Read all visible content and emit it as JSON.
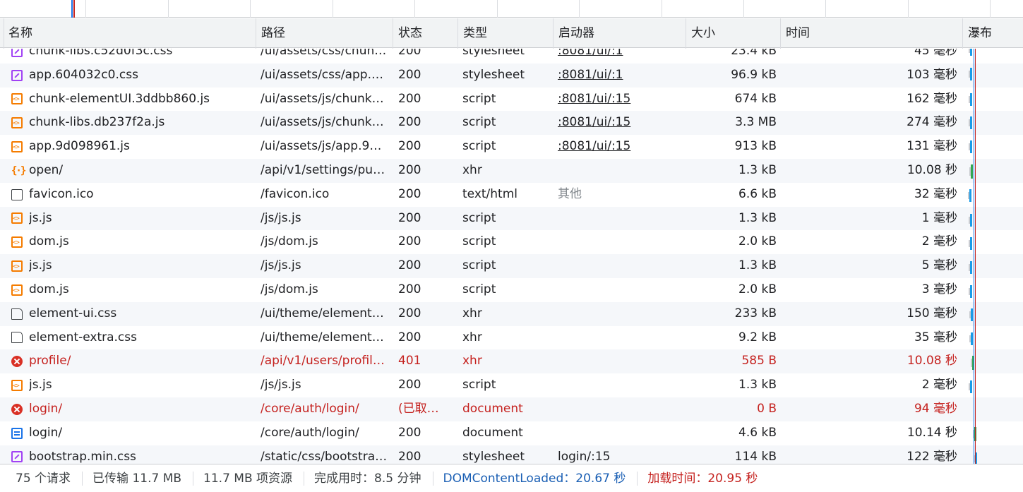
{
  "columns": {
    "name": "名称",
    "path": "路径",
    "status": "状态",
    "type": "类型",
    "initiator": "启动器",
    "size": "大小",
    "time": "时间",
    "waterfall": "瀑布"
  },
  "rows": [
    {
      "icon": "css-file-icon",
      "name": "chunk-libs.c52d0f3c.css",
      "path": "/ui/assets/css/chun…",
      "status": "200",
      "type": "stylesheet",
      "initiator": ":8081/ui/:1",
      "initiator_link": true,
      "size": "23.4 kB",
      "time": "45 毫秒",
      "error": false
    },
    {
      "icon": "css-file-icon",
      "name": "app.604032c0.css",
      "path": "/ui/assets/css/app.…",
      "status": "200",
      "type": "stylesheet",
      "initiator": ":8081/ui/:1",
      "initiator_link": true,
      "size": "96.9 kB",
      "time": "103 毫秒",
      "error": false
    },
    {
      "icon": "js-file-icon",
      "name": "chunk-elementUI.3ddbb860.js",
      "path": "/ui/assets/js/chunk…",
      "status": "200",
      "type": "script",
      "initiator": ":8081/ui/:15",
      "initiator_link": true,
      "size": "674 kB",
      "time": "162 毫秒",
      "error": false
    },
    {
      "icon": "js-file-icon",
      "name": "chunk-libs.db237f2a.js",
      "path": "/ui/assets/js/chunk…",
      "status": "200",
      "type": "script",
      "initiator": ":8081/ui/:15",
      "initiator_link": true,
      "size": "3.3 MB",
      "time": "274 毫秒",
      "error": false
    },
    {
      "icon": "js-file-icon",
      "name": "app.9d098961.js",
      "path": "/ui/assets/js/app.9…",
      "status": "200",
      "type": "script",
      "initiator": ":8081/ui/:15",
      "initiator_link": true,
      "size": "913 kB",
      "time": "131 毫秒",
      "error": false
    },
    {
      "icon": "xhr-icon",
      "name": "open/",
      "path": "/api/v1/settings/pu…",
      "status": "200",
      "type": "xhr",
      "initiator": "",
      "initiator_link": false,
      "size": "1.3 kB",
      "time": "10.08 秒",
      "error": false
    },
    {
      "icon": "blank-file-icon",
      "name": "favicon.ico",
      "path": "/favicon.ico",
      "status": "200",
      "type": "text/html",
      "initiator": "其他",
      "initiator_link": false,
      "initiator_muted": true,
      "size": "6.6 kB",
      "time": "32 毫秒",
      "error": false
    },
    {
      "icon": "js-file-icon",
      "name": "js.js",
      "path": "/js/js.js",
      "status": "200",
      "type": "script",
      "initiator": "",
      "initiator_link": false,
      "size": "1.3 kB",
      "time": "1 毫秒",
      "error": false
    },
    {
      "icon": "js-file-icon",
      "name": "dom.js",
      "path": "/js/dom.js",
      "status": "200",
      "type": "script",
      "initiator": "",
      "initiator_link": false,
      "size": "2.0 kB",
      "time": "2 毫秒",
      "error": false
    },
    {
      "icon": "js-file-icon",
      "name": "js.js",
      "path": "/js/js.js",
      "status": "200",
      "type": "script",
      "initiator": "",
      "initiator_link": false,
      "size": "1.3 kB",
      "time": "5 毫秒",
      "error": false
    },
    {
      "icon": "js-file-icon",
      "name": "dom.js",
      "path": "/js/dom.js",
      "status": "200",
      "type": "script",
      "initiator": "",
      "initiator_link": false,
      "size": "2.0 kB",
      "time": "3 毫秒",
      "error": false
    },
    {
      "icon": "document-file-icon",
      "name": "element-ui.css",
      "path": "/ui/theme/element…",
      "status": "200",
      "type": "xhr",
      "initiator": "",
      "initiator_link": false,
      "size": "233 kB",
      "time": "150 毫秒",
      "error": false
    },
    {
      "icon": "document-file-icon",
      "name": "element-extra.css",
      "path": "/ui/theme/element…",
      "status": "200",
      "type": "xhr",
      "initiator": "",
      "initiator_link": false,
      "size": "9.2 kB",
      "time": "35 毫秒",
      "error": false
    },
    {
      "icon": "error-icon",
      "name": "profile/",
      "path": "/api/v1/users/profil…",
      "status": "401",
      "type": "xhr",
      "initiator": "",
      "initiator_link": false,
      "size": "585 B",
      "time": "10.08 秒",
      "error": true
    },
    {
      "icon": "js-file-icon",
      "name": "js.js",
      "path": "/js/js.js",
      "status": "200",
      "type": "script",
      "initiator": "",
      "initiator_link": false,
      "size": "1.3 kB",
      "time": "2 毫秒",
      "error": false
    },
    {
      "icon": "error-icon",
      "name": "login/",
      "path": "/core/auth/login/",
      "status": "(已取…",
      "type": "document",
      "initiator": "",
      "initiator_link": false,
      "size": "0 B",
      "time": "94 毫秒",
      "error": true
    },
    {
      "icon": "html-document-icon",
      "name": "login/",
      "path": "/core/auth/login/",
      "status": "200",
      "type": "document",
      "initiator": "",
      "initiator_link": false,
      "size": "4.6 kB",
      "time": "10.14 秒",
      "error": false
    },
    {
      "icon": "css-file-icon",
      "name": "bootstrap.min.css",
      "path": "/static/css/bootstra…",
      "status": "200",
      "type": "stylesheet",
      "initiator": "login/:15",
      "initiator_link": false,
      "size": "114 kB",
      "time": "122 毫秒",
      "error": false
    }
  ],
  "status_bar": {
    "requests": "75 个请求",
    "transferred": "已传输 11.7 MB",
    "resources": "11.7 MB 项资源",
    "finish": "完成用时：8.5 分钟",
    "dom_content_loaded": "DOMContentLoaded：20.67 秒",
    "load": "加载时间：20.95 秒"
  },
  "colors": {
    "dom_content_loaded_line": "#1a73e8",
    "load_line": "#c5221f",
    "waterfall_bar": "#1a9be8",
    "waterfall_wait": "#34a853",
    "error_text": "#c5221f"
  }
}
